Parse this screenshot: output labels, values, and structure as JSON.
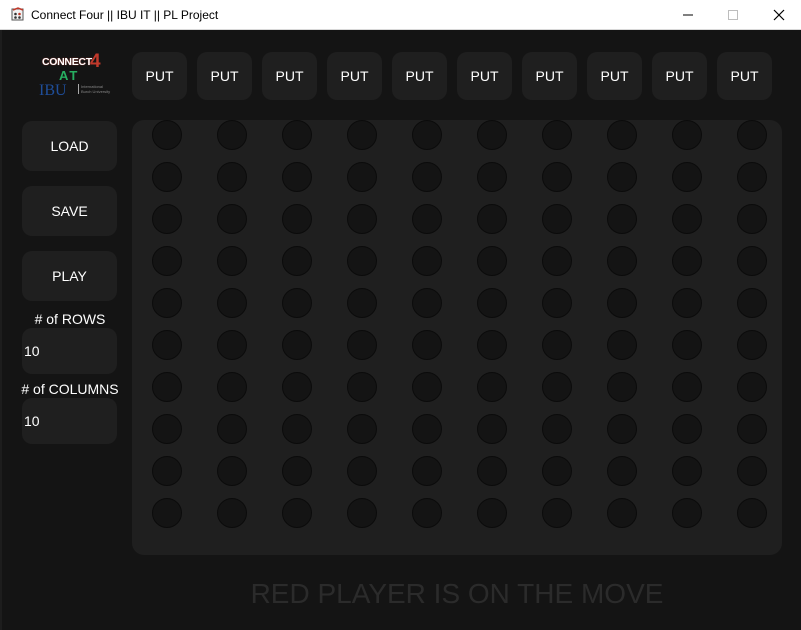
{
  "window": {
    "title": "Connect Four || IBU IT || PL Project",
    "icons": {
      "app": "app-icon",
      "minimize": "minimize-icon",
      "maximize": "maximize-icon",
      "close": "close-icon"
    }
  },
  "logo": {
    "connect": "CONNECT",
    "four": "4",
    "at": "AT",
    "ibu": "IBU",
    "subtitle": "International Burch University"
  },
  "columns": {
    "put_label": "PUT",
    "labels": [
      "PUT",
      "PUT",
      "PUT",
      "PUT",
      "PUT",
      "PUT",
      "PUT",
      "PUT",
      "PUT",
      "PUT"
    ]
  },
  "sidebar": {
    "load_label": "LOAD",
    "save_label": "SAVE",
    "play_label": "PLAY",
    "rows_label": "# of ROWS",
    "rows_value": "10",
    "columns_label": "# of COLUMNS",
    "columns_value": "10"
  },
  "board": {
    "rows": 10,
    "columns": 10,
    "empty_color": "#141414"
  },
  "status": {
    "text": "RED PLAYER IS ON THE MOVE"
  },
  "colors": {
    "background": "#141414",
    "panel": "#1f1f1f",
    "text": "#ffffff",
    "status_text": "#2b2b2b",
    "logo_red": "#c0392b",
    "logo_green": "#27ae60",
    "logo_blue": "#1f4e9a"
  }
}
